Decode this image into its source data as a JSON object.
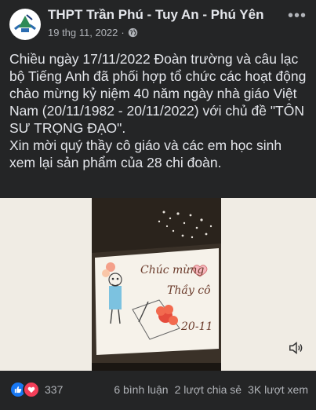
{
  "post": {
    "page_name": "THPT Trần Phú - Tuy An - Phú Yên",
    "date": "19 thg 11, 2022",
    "privacy_icon": "globe-icon",
    "paragraphs": [
      "Chiều ngày 17/11/2022 Đoàn trường và câu lạc bộ Tiếng Anh đã phối hợp tổ chức các hoạt động chào mừng kỷ niệm 40 năm ngày nhà giáo Việt Nam (20/11/1982 - 20/11/2022) với chủ đề \"TÔN SƯ TRỌNG ĐẠO\".",
      "Xin mời quý thầy cô giáo và các em học sinh xem lại sản phẩm của 28 chi đoàn."
    ]
  },
  "video": {
    "card_text_1": "Chúc mừng",
    "card_text_2": "Thầy cô",
    "card_text_3": "20-11"
  },
  "footer": {
    "reaction_count": "337",
    "comments": "6 bình luận",
    "shares": "2 lượt chia sẻ",
    "views": "3K lượt xem"
  },
  "colors": {
    "background": "#242526",
    "text": "#e4e6eb",
    "secondary_text": "#b0b3b8",
    "like": "#1877f2",
    "love": "#f33e58"
  }
}
